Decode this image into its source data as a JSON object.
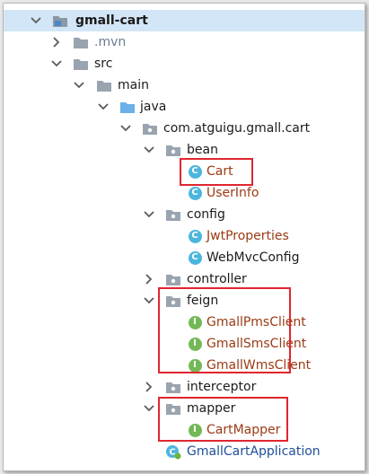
{
  "tree": {
    "root": "gmall-cart",
    "mvn": ".mvn",
    "src": "src",
    "main": "main",
    "java": "java",
    "package": "com.atguigu.gmall.cart",
    "bean": "bean",
    "bean_items": [
      "Cart",
      "UserInfo"
    ],
    "config": "config",
    "config_items": [
      "JwtProperties",
      "WebMvcConfig"
    ],
    "controller": "controller",
    "feign": "feign",
    "feign_items": [
      "GmallPmsClient",
      "GmallSmsClient",
      "GmallWmsClient"
    ],
    "interceptor": "interceptor",
    "mapper": "mapper",
    "mapper_items": [
      "CartMapper"
    ],
    "application": "GmallCartApplication"
  },
  "icons": {
    "class_letter": "C",
    "interface_letter": "I"
  },
  "colors": {
    "selection": "#d2e6f7",
    "highlight_box": "#e0262f",
    "class_icon": "#4bb6dd",
    "interface_icon": "#72b956"
  }
}
